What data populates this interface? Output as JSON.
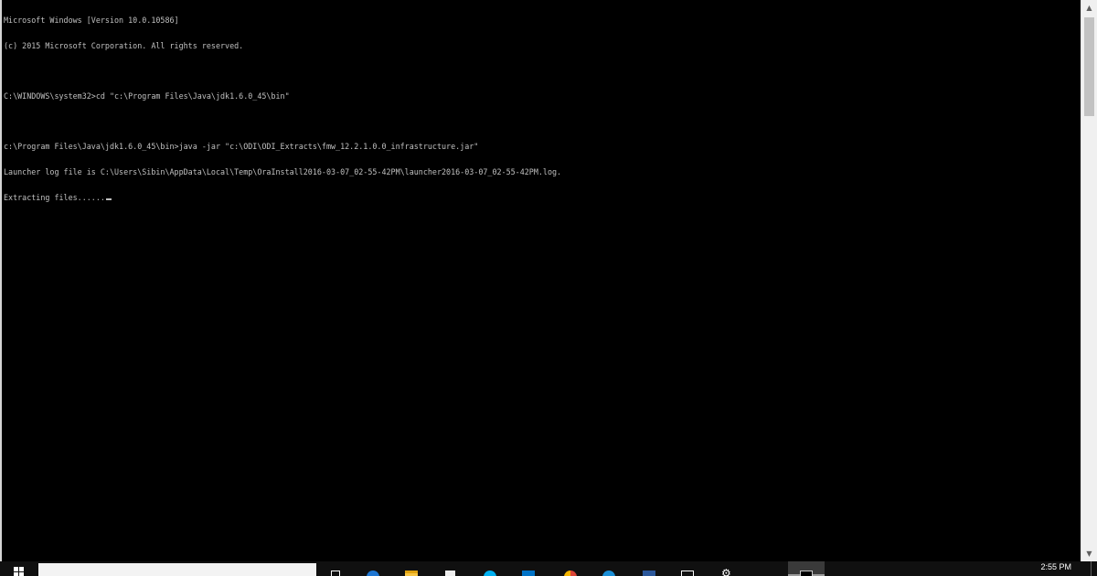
{
  "console": {
    "lines": [
      "Microsoft Windows [Version 10.0.10586]",
      "(c) 2015 Microsoft Corporation. All rights reserved.",
      "",
      "C:\\WINDOWS\\system32>cd \"c:\\Program Files\\Java\\jdk1.6.0_45\\bin\"",
      "",
      "c:\\Program Files\\Java\\jdk1.6.0_45\\bin>java -jar \"c:\\ODI\\ODI_Extracts\\fmw_12.2.1.0.0_infrastructure.jar\"",
      "Launcher log file is C:\\Users\\Sibin\\AppData\\Local\\Temp\\OraInstall2016-03-07_02-55-42PM\\launcher2016-03-07_02-55-42PM.log.",
      "Extracting files......"
    ],
    "text_color": "#c0c0c0",
    "background": "#000000"
  },
  "taskbar": {
    "clock": "2:55 PM",
    "icons": [
      "start-windows-icon",
      "task-view-icon",
      "edge-browser-icon",
      "file-explorer-icon",
      "notepad-icon",
      "skype-icon",
      "outlook-icon",
      "chrome-icon",
      "skype-business-icon",
      "word-icon",
      "snipping-tool-icon",
      "settings-gear-icon",
      "command-prompt-icon"
    ]
  }
}
